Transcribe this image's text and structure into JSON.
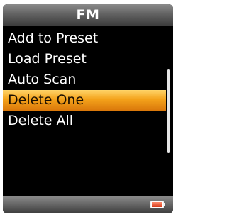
{
  "header": {
    "title": "FM"
  },
  "menu": {
    "items": [
      {
        "label": "Add to Preset",
        "selected": false
      },
      {
        "label": "Load Preset",
        "selected": false
      },
      {
        "label": "Auto Scan",
        "selected": false
      },
      {
        "label": "Delete One",
        "selected": true
      },
      {
        "label": "Delete All",
        "selected": false
      }
    ]
  },
  "status_bar": {
    "battery_icon": "battery-icon",
    "battery_level": 1.0
  },
  "colors": {
    "highlight": "#f4a21b",
    "background": "#000000",
    "text": "#ffffff"
  }
}
